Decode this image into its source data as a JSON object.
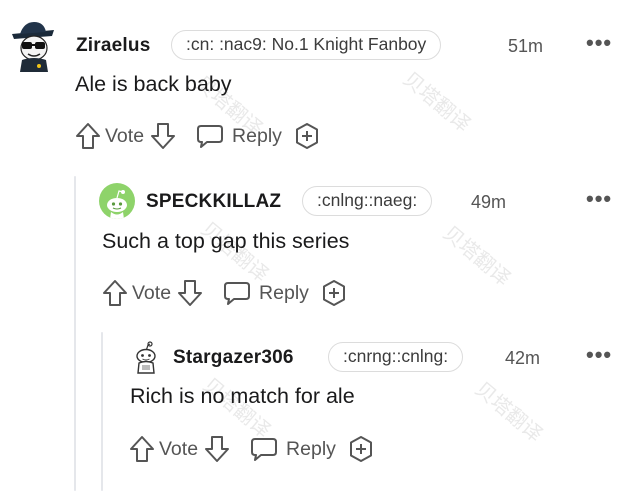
{
  "comments": [
    {
      "username": "Ziraelus",
      "flair": ":cn: :nac9: No.1 Knight Fanboy",
      "time": "51m",
      "text": "Ale is back baby",
      "vote_label": "Vote",
      "reply_label": "Reply",
      "more_label": "•••"
    },
    {
      "username": "SPECKKILLAZ",
      "flair": ":cnlng::naeg:",
      "time": "49m",
      "text": "Such a top gap this series",
      "vote_label": "Vote",
      "reply_label": "Reply",
      "more_label": "•••"
    },
    {
      "username": "Stargazer306",
      "flair": ":cnrng::cnlng:",
      "time": "42m",
      "text": "Rich is no match for ale",
      "vote_label": "Vote",
      "reply_label": "Reply",
      "more_label": "•••"
    }
  ],
  "watermark_text": "贝塔翻译",
  "colors": {
    "text": "#1a1a1b",
    "muted": "#555555",
    "flair_border": "#dcdcdc",
    "thread_line": "#e5e7eb",
    "snoo_green": "#8ed36a"
  },
  "icons": [
    "avatar-sunglasses",
    "snoo-avatar",
    "snoo-outline-avatar",
    "upvote-arrow",
    "downvote-arrow",
    "reply-bubble",
    "award-plus"
  ]
}
